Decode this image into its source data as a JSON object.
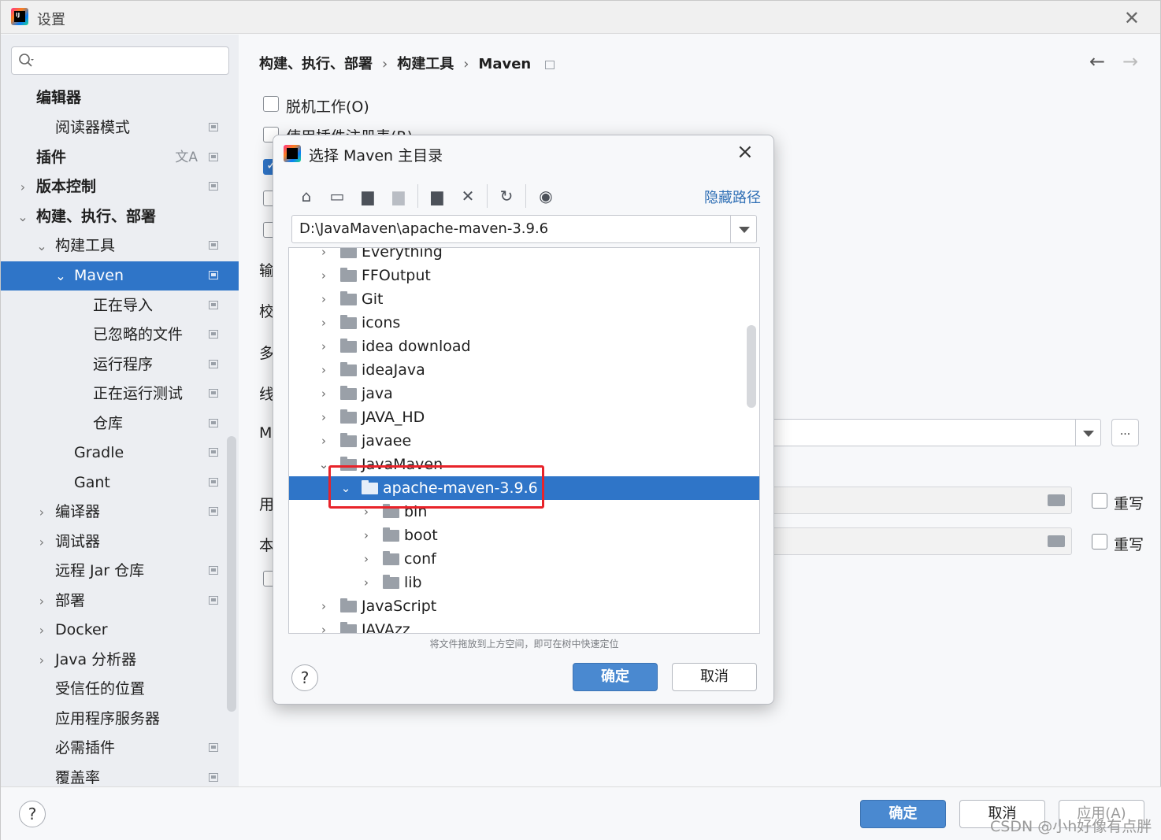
{
  "window": {
    "title": "设置",
    "close_glyph": "✕"
  },
  "sidebar": {
    "search_placeholder": "",
    "items": [
      {
        "label": "编辑器"
      },
      {
        "label": "阅读器模式"
      },
      {
        "label": "插件"
      },
      {
        "label": "版本控制"
      },
      {
        "label": "构建、执行、部署"
      },
      {
        "label": "构建工具"
      },
      {
        "label": "Maven"
      },
      {
        "label": "正在导入"
      },
      {
        "label": "已忽略的文件"
      },
      {
        "label": "运行程序"
      },
      {
        "label": "正在运行测试"
      },
      {
        "label": "仓库"
      },
      {
        "label": "Gradle"
      },
      {
        "label": "Gant"
      },
      {
        "label": "编译器"
      },
      {
        "label": "调试器"
      },
      {
        "label": "远程 Jar 仓库"
      },
      {
        "label": "部署"
      },
      {
        "label": "Docker"
      },
      {
        "label": "Java 分析器"
      },
      {
        "label": "受信任的位置"
      },
      {
        "label": "应用程序服务器"
      },
      {
        "label": "必需插件"
      },
      {
        "label": "覆盖率"
      }
    ]
  },
  "main": {
    "breadcrumb": [
      "构建、执行、部署",
      "构建工具",
      "Maven"
    ],
    "breadcrumb_sep": "›",
    "offline_label": "脱机工作(O)",
    "plugin_registry_label": "使用插件注册表(R)",
    "partial_labels": [
      "输",
      "校",
      "多",
      "线",
      "M",
      "用",
      "本"
    ],
    "override_label": "重写",
    "dots_label": "..."
  },
  "dialog": {
    "title": "选择 Maven 主目录",
    "hide_path": "隐藏路径",
    "path_value": "D:\\JavaMaven\\apache-maven-3.9.6",
    "tree": [
      {
        "name": "Everything"
      },
      {
        "name": "FFOutput"
      },
      {
        "name": "Git"
      },
      {
        "name": "icons"
      },
      {
        "name": "idea download"
      },
      {
        "name": "ideaJava"
      },
      {
        "name": "java"
      },
      {
        "name": "JAVA_HD"
      },
      {
        "name": "javaee"
      },
      {
        "name": "JavaMaven"
      },
      {
        "name": "apache-maven-3.9.6"
      },
      {
        "name": "bin"
      },
      {
        "name": "boot"
      },
      {
        "name": "conf"
      },
      {
        "name": "lib"
      },
      {
        "name": "JavaScript"
      },
      {
        "name": "JAVAzz"
      }
    ],
    "hint": "将文件拖放到上方空间，即可在树中快速定位",
    "ok_label": "确定",
    "cancel_label": "取消"
  },
  "footer": {
    "help": "?",
    "ok_label": "确定",
    "cancel_label": "取消",
    "apply_label": "应用(A)",
    "watermark": "CSDN @小h好像有点胖"
  },
  "colors": {
    "accent": "#2f75c8",
    "highlight_box": "#e8232a"
  }
}
